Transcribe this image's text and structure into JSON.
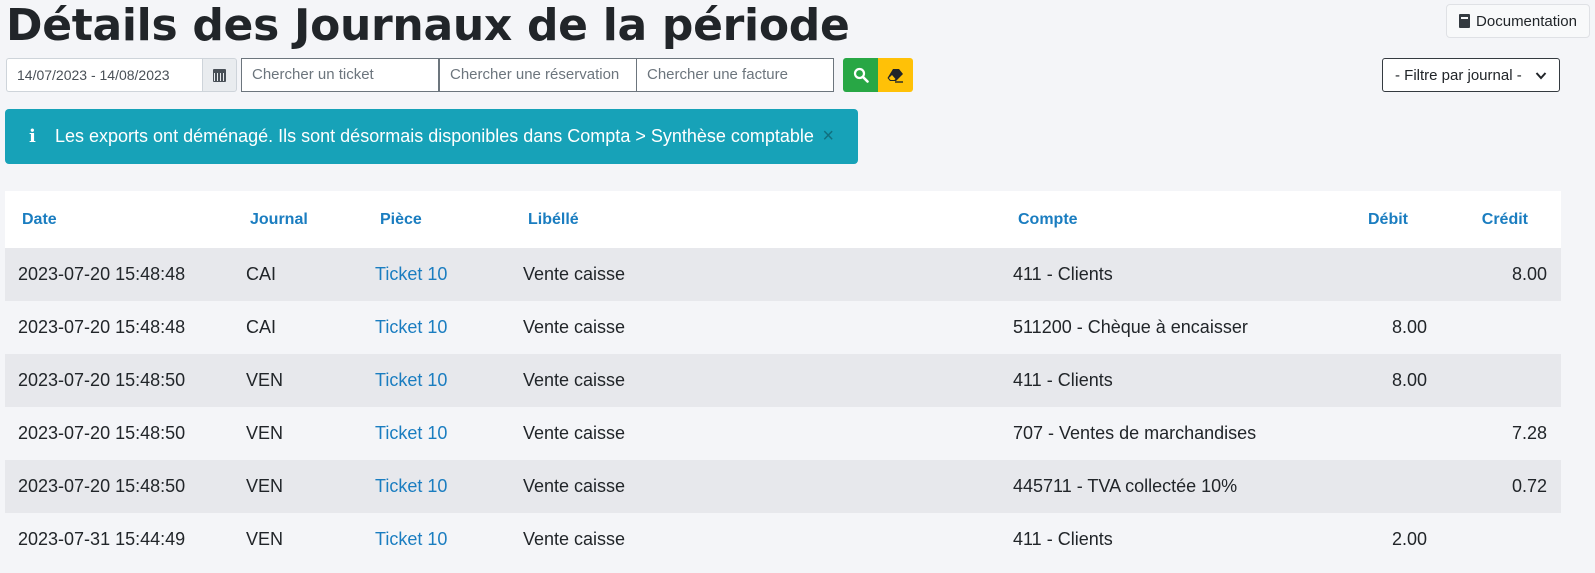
{
  "page": {
    "title": "Détails des Journaux de la période",
    "documentation_label": "Documentation"
  },
  "toolbar": {
    "date_range": "14/07/2023 - 14/08/2023",
    "ticket_placeholder": "Chercher un ticket",
    "reservation_placeholder": "Chercher une réservation",
    "invoice_placeholder": "Chercher une facture",
    "journal_filter": "- Filtre par journal -"
  },
  "alert": {
    "text": "Les exports ont déménagé. Ils sont désormais disponibles dans Compta > Synthèse comptable",
    "close": "×"
  },
  "table": {
    "headers": {
      "date": "Date",
      "journal": "Journal",
      "piece": "Pièce",
      "libelle": "Libéllé",
      "compte": "Compte",
      "debit": "Débit",
      "credit": "Crédit"
    },
    "rows": [
      {
        "date": "2023-07-20 15:48:48",
        "journal": "CAI",
        "piece": "Ticket 10",
        "libelle": "Vente caisse",
        "compte": "411 - Clients",
        "debit": "",
        "credit": "8.00"
      },
      {
        "date": "2023-07-20 15:48:48",
        "journal": "CAI",
        "piece": "Ticket 10",
        "libelle": "Vente caisse",
        "compte": "511200 - Chèque à encaisser",
        "debit": "8.00",
        "credit": ""
      },
      {
        "date": "2023-07-20 15:48:50",
        "journal": "VEN",
        "piece": "Ticket 10",
        "libelle": "Vente caisse",
        "compte": "411 - Clients",
        "debit": "8.00",
        "credit": ""
      },
      {
        "date": "2023-07-20 15:48:50",
        "journal": "VEN",
        "piece": "Ticket 10",
        "libelle": "Vente caisse",
        "compte": "707 - Ventes de marchandises",
        "debit": "",
        "credit": "7.28"
      },
      {
        "date": "2023-07-20 15:48:50",
        "journal": "VEN",
        "piece": "Ticket 10",
        "libelle": "Vente caisse",
        "compte": "445711 - TVA collectée 10%",
        "debit": "",
        "credit": "0.72"
      },
      {
        "date": "2023-07-31 15:44:49",
        "journal": "VEN",
        "piece": "Ticket 10",
        "libelle": "Vente caisse",
        "compte": "411 - Clients",
        "debit": "2.00",
        "credit": ""
      }
    ]
  },
  "colors": {
    "accent_link": "#1a7dc0",
    "alert_info": "#17a2b8",
    "search_button": "#28a745",
    "clear_button": "#ffc107"
  },
  "icons": {
    "documentation": "book-icon",
    "date": "calendar-icon",
    "search": "search-icon",
    "clear": "eraser-icon",
    "alert": "info-icon",
    "filter": "chevron-down-icon"
  }
}
